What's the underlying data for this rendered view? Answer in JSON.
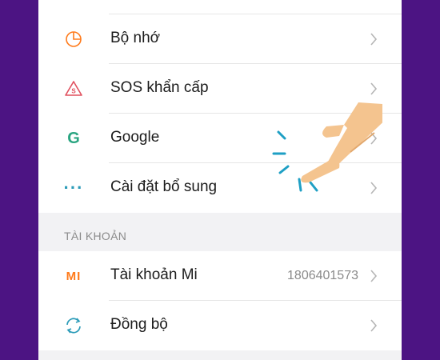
{
  "settings": {
    "items": [
      {
        "label": "Bộ nhớ",
        "icon": "pie-chart-icon"
      },
      {
        "label": "SOS khẩn cấp",
        "icon": "sos-icon"
      },
      {
        "label": "Google",
        "icon": "google-icon"
      },
      {
        "label": "Cài đặt bổ sung",
        "icon": "more-dots-icon"
      }
    ]
  },
  "account": {
    "header": "TÀI KHOẢN",
    "items": [
      {
        "label": "Tài khoản Mi",
        "value": "1806401573",
        "icon": "mi-icon",
        "icon_text": "MI"
      },
      {
        "label": "Đồng bộ",
        "icon": "sync-icon"
      }
    ]
  },
  "icons": {
    "google_letter": "G",
    "more_dots": "···"
  },
  "colors": {
    "background": "#4c1483",
    "orange": "#ff7a1a",
    "sos_red": "#e0505e",
    "google_green": "#2aa581",
    "cyan": "#2b9bb8"
  }
}
